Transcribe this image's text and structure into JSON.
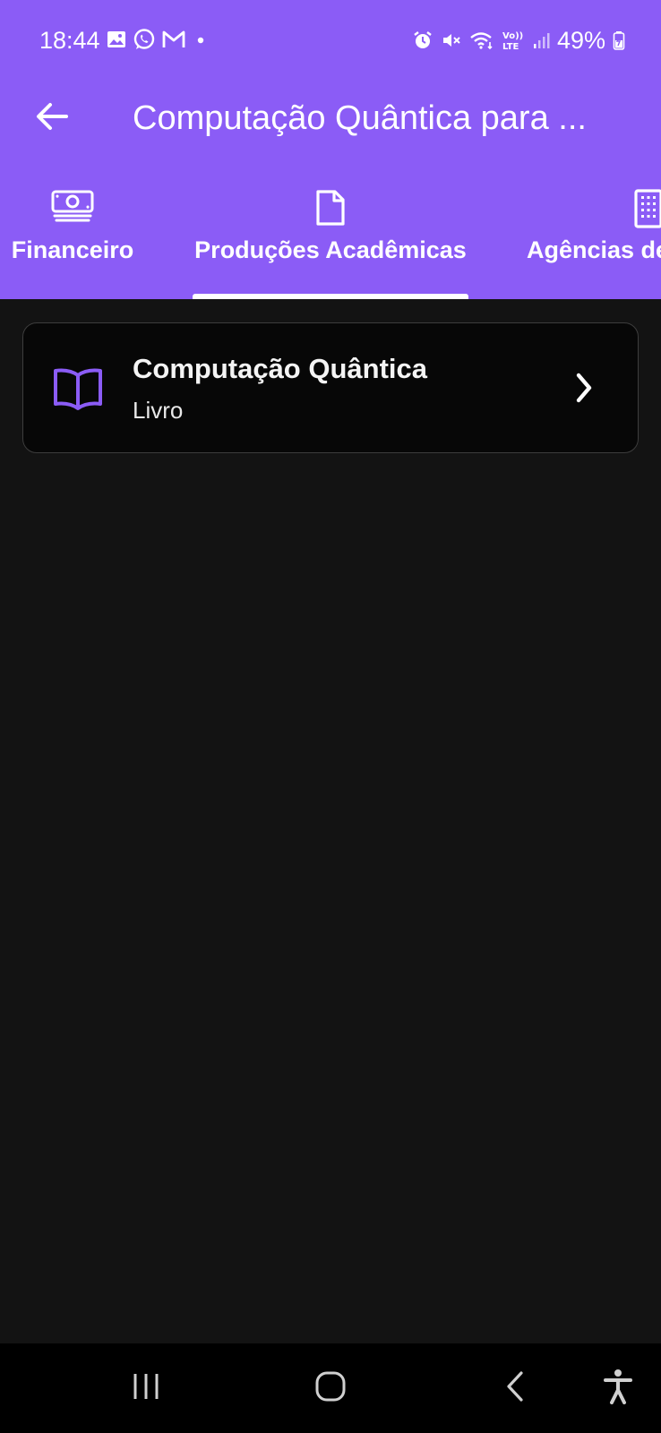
{
  "status_bar": {
    "time": "18:44",
    "battery": "49%",
    "left_icons": [
      "gallery-icon",
      "whatsapp-icon",
      "gmail-icon",
      "dot-icon"
    ],
    "right_icons": [
      "alarm-icon",
      "mute-icon",
      "wifi-icon",
      "volte-icon",
      "signal-icon",
      "battery-icon"
    ]
  },
  "app_bar": {
    "title": "Computação Quântica para ...",
    "back_icon": "arrow-left-icon"
  },
  "tabs": [
    {
      "label": "Financeiro",
      "icon": "money-icon",
      "selected": false
    },
    {
      "label": "Produções Acadêmicas",
      "icon": "document-icon",
      "selected": true
    },
    {
      "label": "Agências de",
      "icon": "building-icon",
      "selected": false
    }
  ],
  "items": [
    {
      "title": "Computação Quântica",
      "subtitle": "Livro",
      "icon": "book-icon"
    }
  ],
  "nav_bar": {
    "icons": [
      "recent-apps-icon",
      "home-icon",
      "back-icon",
      "accessibility-icon"
    ]
  },
  "colors": {
    "primary": "#8b5cf6",
    "background": "#131313",
    "card": "#070707",
    "card_border": "#3d3d3d",
    "accent_icon": "#8b5cf6"
  }
}
